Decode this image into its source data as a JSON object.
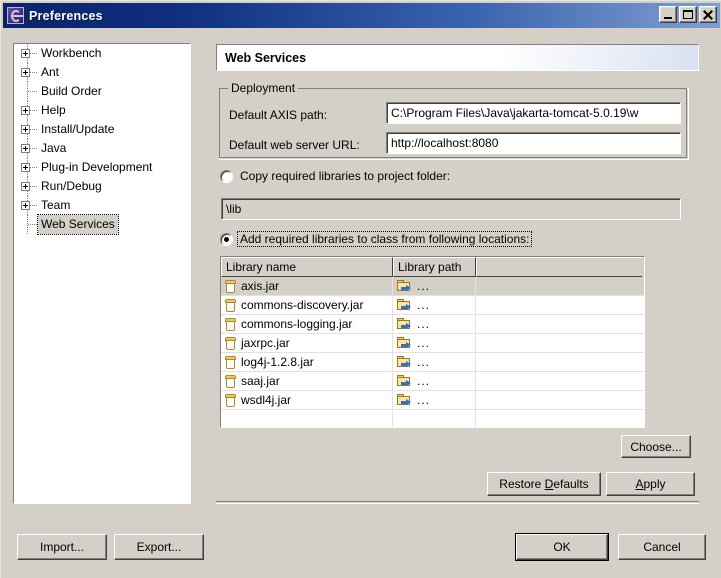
{
  "window": {
    "title": "Preferences",
    "icon": "eclipse-globe-icon",
    "controls": {
      "minimize": "Minimize",
      "maximize": "Maximize",
      "close": "Close"
    }
  },
  "tree": {
    "items": [
      {
        "label": "Workbench",
        "expandable": true,
        "selected": false
      },
      {
        "label": "Ant",
        "expandable": true,
        "selected": false
      },
      {
        "label": "Build Order",
        "expandable": false,
        "selected": false
      },
      {
        "label": "Help",
        "expandable": true,
        "selected": false
      },
      {
        "label": "Install/Update",
        "expandable": true,
        "selected": false
      },
      {
        "label": "Java",
        "expandable": true,
        "selected": false
      },
      {
        "label": "Plug-in Development",
        "expandable": true,
        "selected": false
      },
      {
        "label": "Run/Debug",
        "expandable": true,
        "selected": false
      },
      {
        "label": "Team",
        "expandable": true,
        "selected": false
      },
      {
        "label": "Web Services",
        "expandable": false,
        "selected": true
      }
    ]
  },
  "page": {
    "banner_title": "Web Services",
    "deployment": {
      "legend": "Deployment",
      "axis_path": {
        "label": "Default AXIS path:",
        "value": "C:\\Program Files\\Java\\jakarta-tomcat-5.0.19\\w"
      },
      "web_server_url": {
        "label": "Default web server URL:",
        "value": "http://localhost:8080"
      }
    },
    "library_mode": {
      "copy": {
        "label": "Copy required libraries to project folder:",
        "selected": false,
        "path_value": "\\lib"
      },
      "add": {
        "label": "Add required libraries to class from following locations:",
        "selected": true,
        "focused": true
      }
    },
    "table": {
      "columns": [
        "Library name",
        "Library path",
        ""
      ],
      "rows": [
        {
          "name": "axis.jar",
          "path": "...",
          "selected": true
        },
        {
          "name": "commons-discovery.jar",
          "path": "...",
          "selected": false
        },
        {
          "name": "commons-logging.jar",
          "path": "...",
          "selected": false
        },
        {
          "name": "jaxrpc.jar",
          "path": "...",
          "selected": false
        },
        {
          "name": "log4j-1.2.8.jar",
          "path": "...",
          "selected": false
        },
        {
          "name": "saaj.jar",
          "path": "...",
          "selected": false
        },
        {
          "name": "wsdl4j.jar",
          "path": "...",
          "selected": false
        }
      ]
    },
    "buttons": {
      "choose": "Choose...",
      "restore_defaults": "Restore Defaults",
      "restore_defaults_mnemonic": "D",
      "apply": "Apply",
      "apply_mnemonic": "A"
    }
  },
  "footer": {
    "import": "Import...",
    "export": "Export...",
    "ok": "OK",
    "cancel": "Cancel"
  },
  "colors": {
    "dialog_face": "#d4d0c8",
    "title_active_start": "#0a246a",
    "title_active_end": "#7f9ed4",
    "field_bg": "#ffffff",
    "selection": "#d4d0c8"
  }
}
